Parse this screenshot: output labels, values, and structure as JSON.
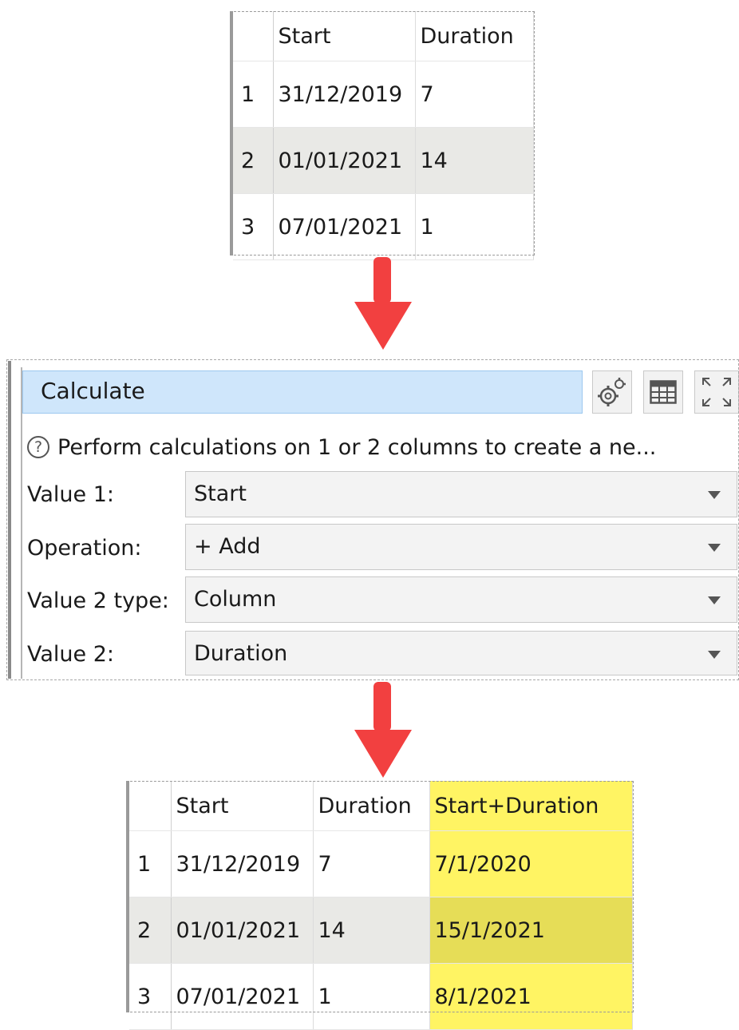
{
  "input_table": {
    "headers": [
      "",
      "Start",
      "Duration"
    ],
    "rows": [
      [
        "1",
        "31/12/2019",
        "7"
      ],
      [
        "2",
        "01/01/2021",
        "14"
      ],
      [
        "3",
        "07/01/2021",
        "1"
      ]
    ]
  },
  "calculate": {
    "title": "Calculate",
    "help_text": "Perform calculations on 1 or 2 columns to create a ne...",
    "fields": [
      {
        "label": "Value 1:",
        "value": "Start"
      },
      {
        "label": "Operation:",
        "value": "+ Add"
      },
      {
        "label": "Value 2 type:",
        "value": "Column"
      },
      {
        "label": "Value 2:",
        "value": "Duration"
      }
    ],
    "icons": [
      "settings-gear-icon",
      "table-view-icon",
      "maximize-icon"
    ]
  },
  "output_table": {
    "headers": [
      "",
      "Start",
      "Duration",
      "Start+Duration"
    ],
    "rows": [
      [
        "1",
        "31/12/2019",
        "7",
        "7/1/2020"
      ],
      [
        "2",
        "01/01/2021",
        "14",
        "15/1/2021"
      ],
      [
        "3",
        "07/01/2021",
        "1",
        "8/1/2021"
      ]
    ]
  },
  "colors": {
    "arrow": "#f24040",
    "highlight": "#fff463",
    "title_bar": "#cfe6fb"
  }
}
